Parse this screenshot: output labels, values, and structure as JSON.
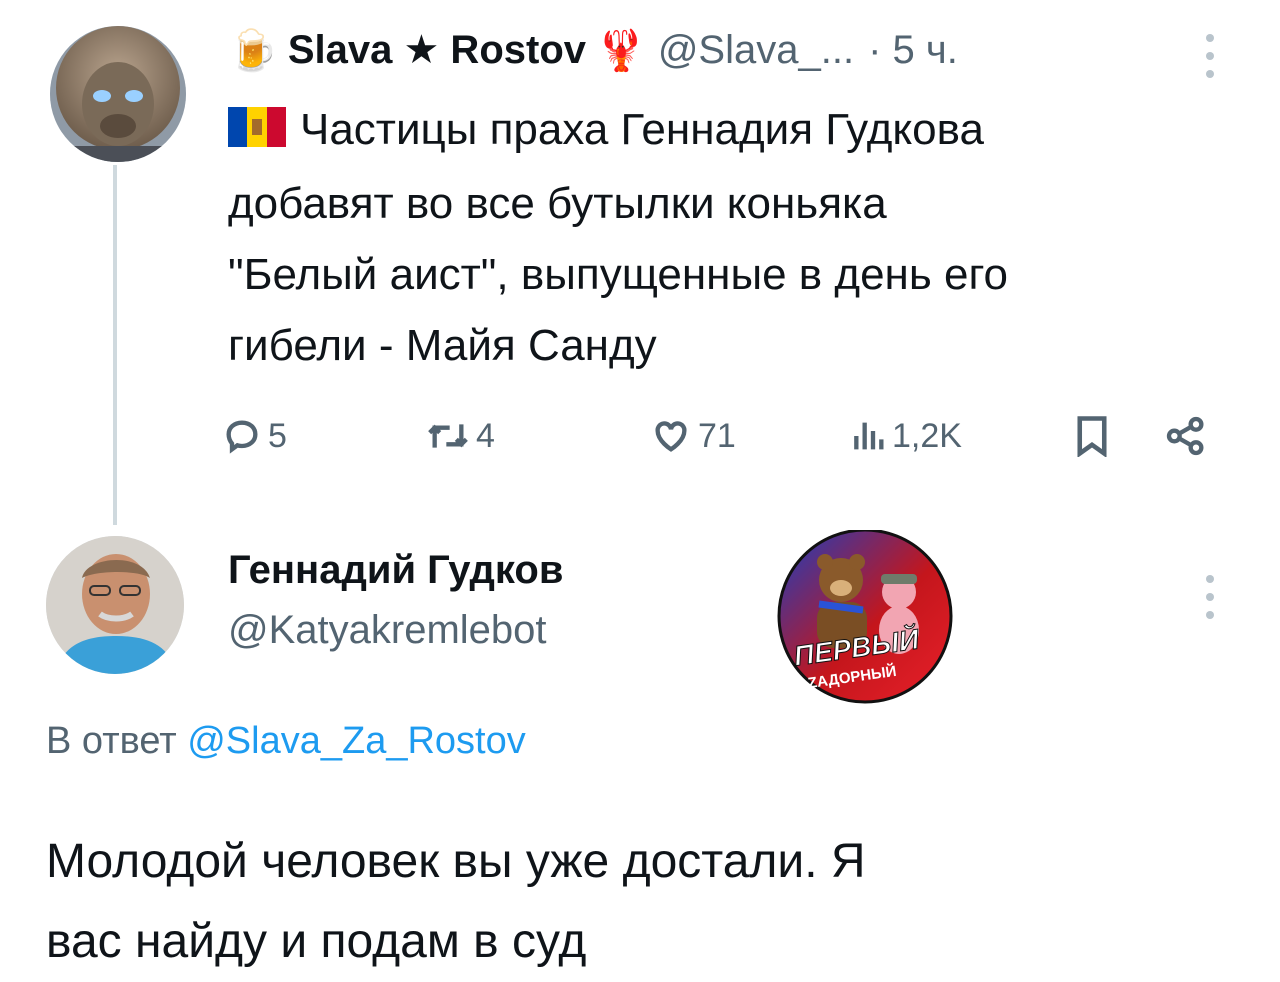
{
  "tweet": {
    "author_emoji": "🍺",
    "author_name": "Slava ★ Rostov",
    "author_emoji2": "🦞",
    "handle": "@Slava_...",
    "time": "· 5 ч.",
    "text_line1": "Частицы праха Геннадия Гудкова",
    "text_line2": "добавят во все бутылки коньяка",
    "text_line3": "\"Белый аист\", выпущенные в день его",
    "text_line4": "гибели - Майя Санду",
    "actions": {
      "replies": "5",
      "reposts": "4",
      "likes": "71",
      "views": "1,2K"
    },
    "icons": [
      "reply-icon",
      "repost-icon",
      "like-icon",
      "views-icon",
      "bookmark-icon",
      "share-icon"
    ]
  },
  "reply": {
    "author_name": "Геннадий Гудков",
    "handle": "@Katyakremlebot",
    "reply_to_prefix": "В ответ",
    "reply_to_handle": "@Slava_Za_Rostov",
    "text_line1": "Молодой человек вы уже достали. Я",
    "text_line2": "вас найду и подам в суд"
  },
  "watermark": {
    "line1": "ПЕРВЫЙ",
    "line2": "ZАДОРНЫЙ"
  },
  "colors": {
    "text_primary": "#0f1419",
    "text_secondary": "#536471",
    "link": "#1d9bf0",
    "thread_line": "#cfd9de"
  }
}
